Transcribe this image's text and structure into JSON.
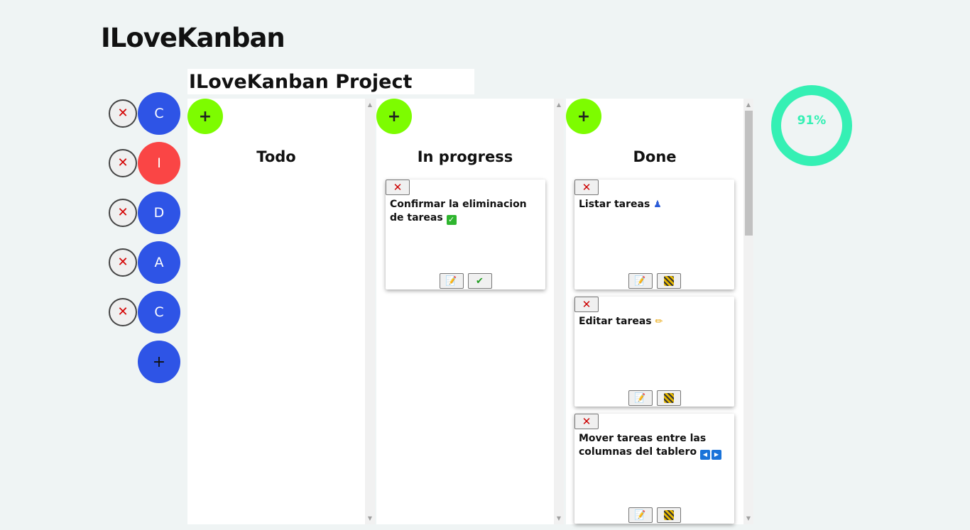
{
  "app_title": "ILoveKanban",
  "project_title": "ILoveKanban Project",
  "boards": [
    {
      "letter": "C",
      "color": "#2e54e6"
    },
    {
      "letter": "I",
      "color": "#fa4545"
    },
    {
      "letter": "D",
      "color": "#2e54e6"
    },
    {
      "letter": "A",
      "color": "#2e54e6"
    },
    {
      "letter": "C",
      "color": "#2e54e6"
    }
  ],
  "add_board_symbol": "+",
  "delete_symbol": "✕",
  "add_task_symbol": "+",
  "columns": [
    {
      "title": "Todo",
      "cards": []
    },
    {
      "title": "In progress",
      "cards": [
        {
          "text": "Confirmar la eliminacion de tareas",
          "emoji": "check-box-icon",
          "actions": [
            "edit-icon",
            "check-icon"
          ]
        }
      ]
    },
    {
      "title": "Done",
      "cards": [
        {
          "text": "Listar tareas",
          "emoji": "person-icon",
          "actions": [
            "edit-icon",
            "barrier-icon"
          ]
        },
        {
          "text": "Editar tareas",
          "emoji": "pencil-icon",
          "actions": [
            "edit-icon",
            "barrier-icon"
          ]
        },
        {
          "text": "Mover tareas entre las columnas del tablero",
          "emoji": "arrows-icon",
          "actions": [
            "edit-icon",
            "barrier-icon"
          ]
        }
      ]
    }
  ],
  "progress": {
    "value": 91,
    "label": "91%",
    "color": "#35f0b4"
  }
}
